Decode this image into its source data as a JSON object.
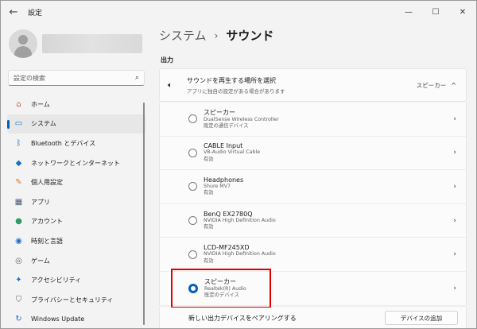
{
  "window": {
    "title": "設定",
    "back_icon": "←",
    "minimize": "—",
    "maximize": "☐",
    "close": "✕"
  },
  "sidebar": {
    "search_placeholder": "設定の検索",
    "search_icon": "⌕",
    "items": [
      {
        "label": "ホーム",
        "icon": "home-icon",
        "glyph": "⌂",
        "color": "#c0603a"
      },
      {
        "label": "システム",
        "icon": "system-icon",
        "glyph": "▭",
        "color": "#1d6fc4",
        "active": true
      },
      {
        "label": "Bluetooth とデバイス",
        "icon": "bluetooth-icon",
        "glyph": "ᛒ",
        "color": "#1d6fc4"
      },
      {
        "label": "ネットワークとインターネット",
        "icon": "wifi-icon",
        "glyph": "◆",
        "color": "#1d6fc4"
      },
      {
        "label": "個人用設定",
        "icon": "brush-icon",
        "glyph": "✎",
        "color": "#d07b2a"
      },
      {
        "label": "アプリ",
        "icon": "apps-icon",
        "glyph": "▦",
        "color": "#4a5a7a"
      },
      {
        "label": "アカウント",
        "icon": "account-icon",
        "glyph": "●",
        "color": "#2e9b6a"
      },
      {
        "label": "時刻と言語",
        "icon": "globe-clock-icon",
        "glyph": "◉",
        "color": "#1d6fc4"
      },
      {
        "label": "ゲーム",
        "icon": "gamepad-icon",
        "glyph": "◎",
        "color": "#666666"
      },
      {
        "label": "アクセシビリティ",
        "icon": "accessibility-icon",
        "glyph": "✦",
        "color": "#1d6fc4"
      },
      {
        "label": "プライバシーとセキュリティ",
        "icon": "shield-icon",
        "glyph": "⛉",
        "color": "#666666"
      },
      {
        "label": "Windows Update",
        "icon": "update-icon",
        "glyph": "↻",
        "color": "#1d6fc4"
      }
    ]
  },
  "main": {
    "breadcrumb_parent": "システム",
    "breadcrumb_sep": "›",
    "breadcrumb_current": "サウンド",
    "section": "出力",
    "output_header": {
      "title": "サウンドを再生する場所を選択",
      "subtitle": "アプリに独自の設定がある場合があります",
      "value": "スピーカー",
      "chevron": "^"
    },
    "devices": [
      {
        "name": "スピーカー",
        "detail": "DualSense Wireless Controller",
        "status": "既定の通信デバイス",
        "selected": false
      },
      {
        "name": "CABLE Input",
        "detail": "VB-Audio Virtual Cable",
        "status": "有効",
        "selected": false
      },
      {
        "name": "Headphones",
        "detail": "Shure MV7",
        "status": "有効",
        "selected": false
      },
      {
        "name": "BenQ EX2780Q",
        "detail": "NVIDIA High Definition Audio",
        "status": "有効",
        "selected": false
      },
      {
        "name": "LCD-MF245XD",
        "detail": "NVIDIA High Definition Audio",
        "status": "有効",
        "selected": false
      },
      {
        "name": "スピーカー",
        "detail": "Realtek(R) Audio",
        "status": "既定のデバイス",
        "selected": true
      }
    ],
    "pair_label": "新しい出力デバイスをペアリングする",
    "add_device_button": "デバイスの追加"
  }
}
